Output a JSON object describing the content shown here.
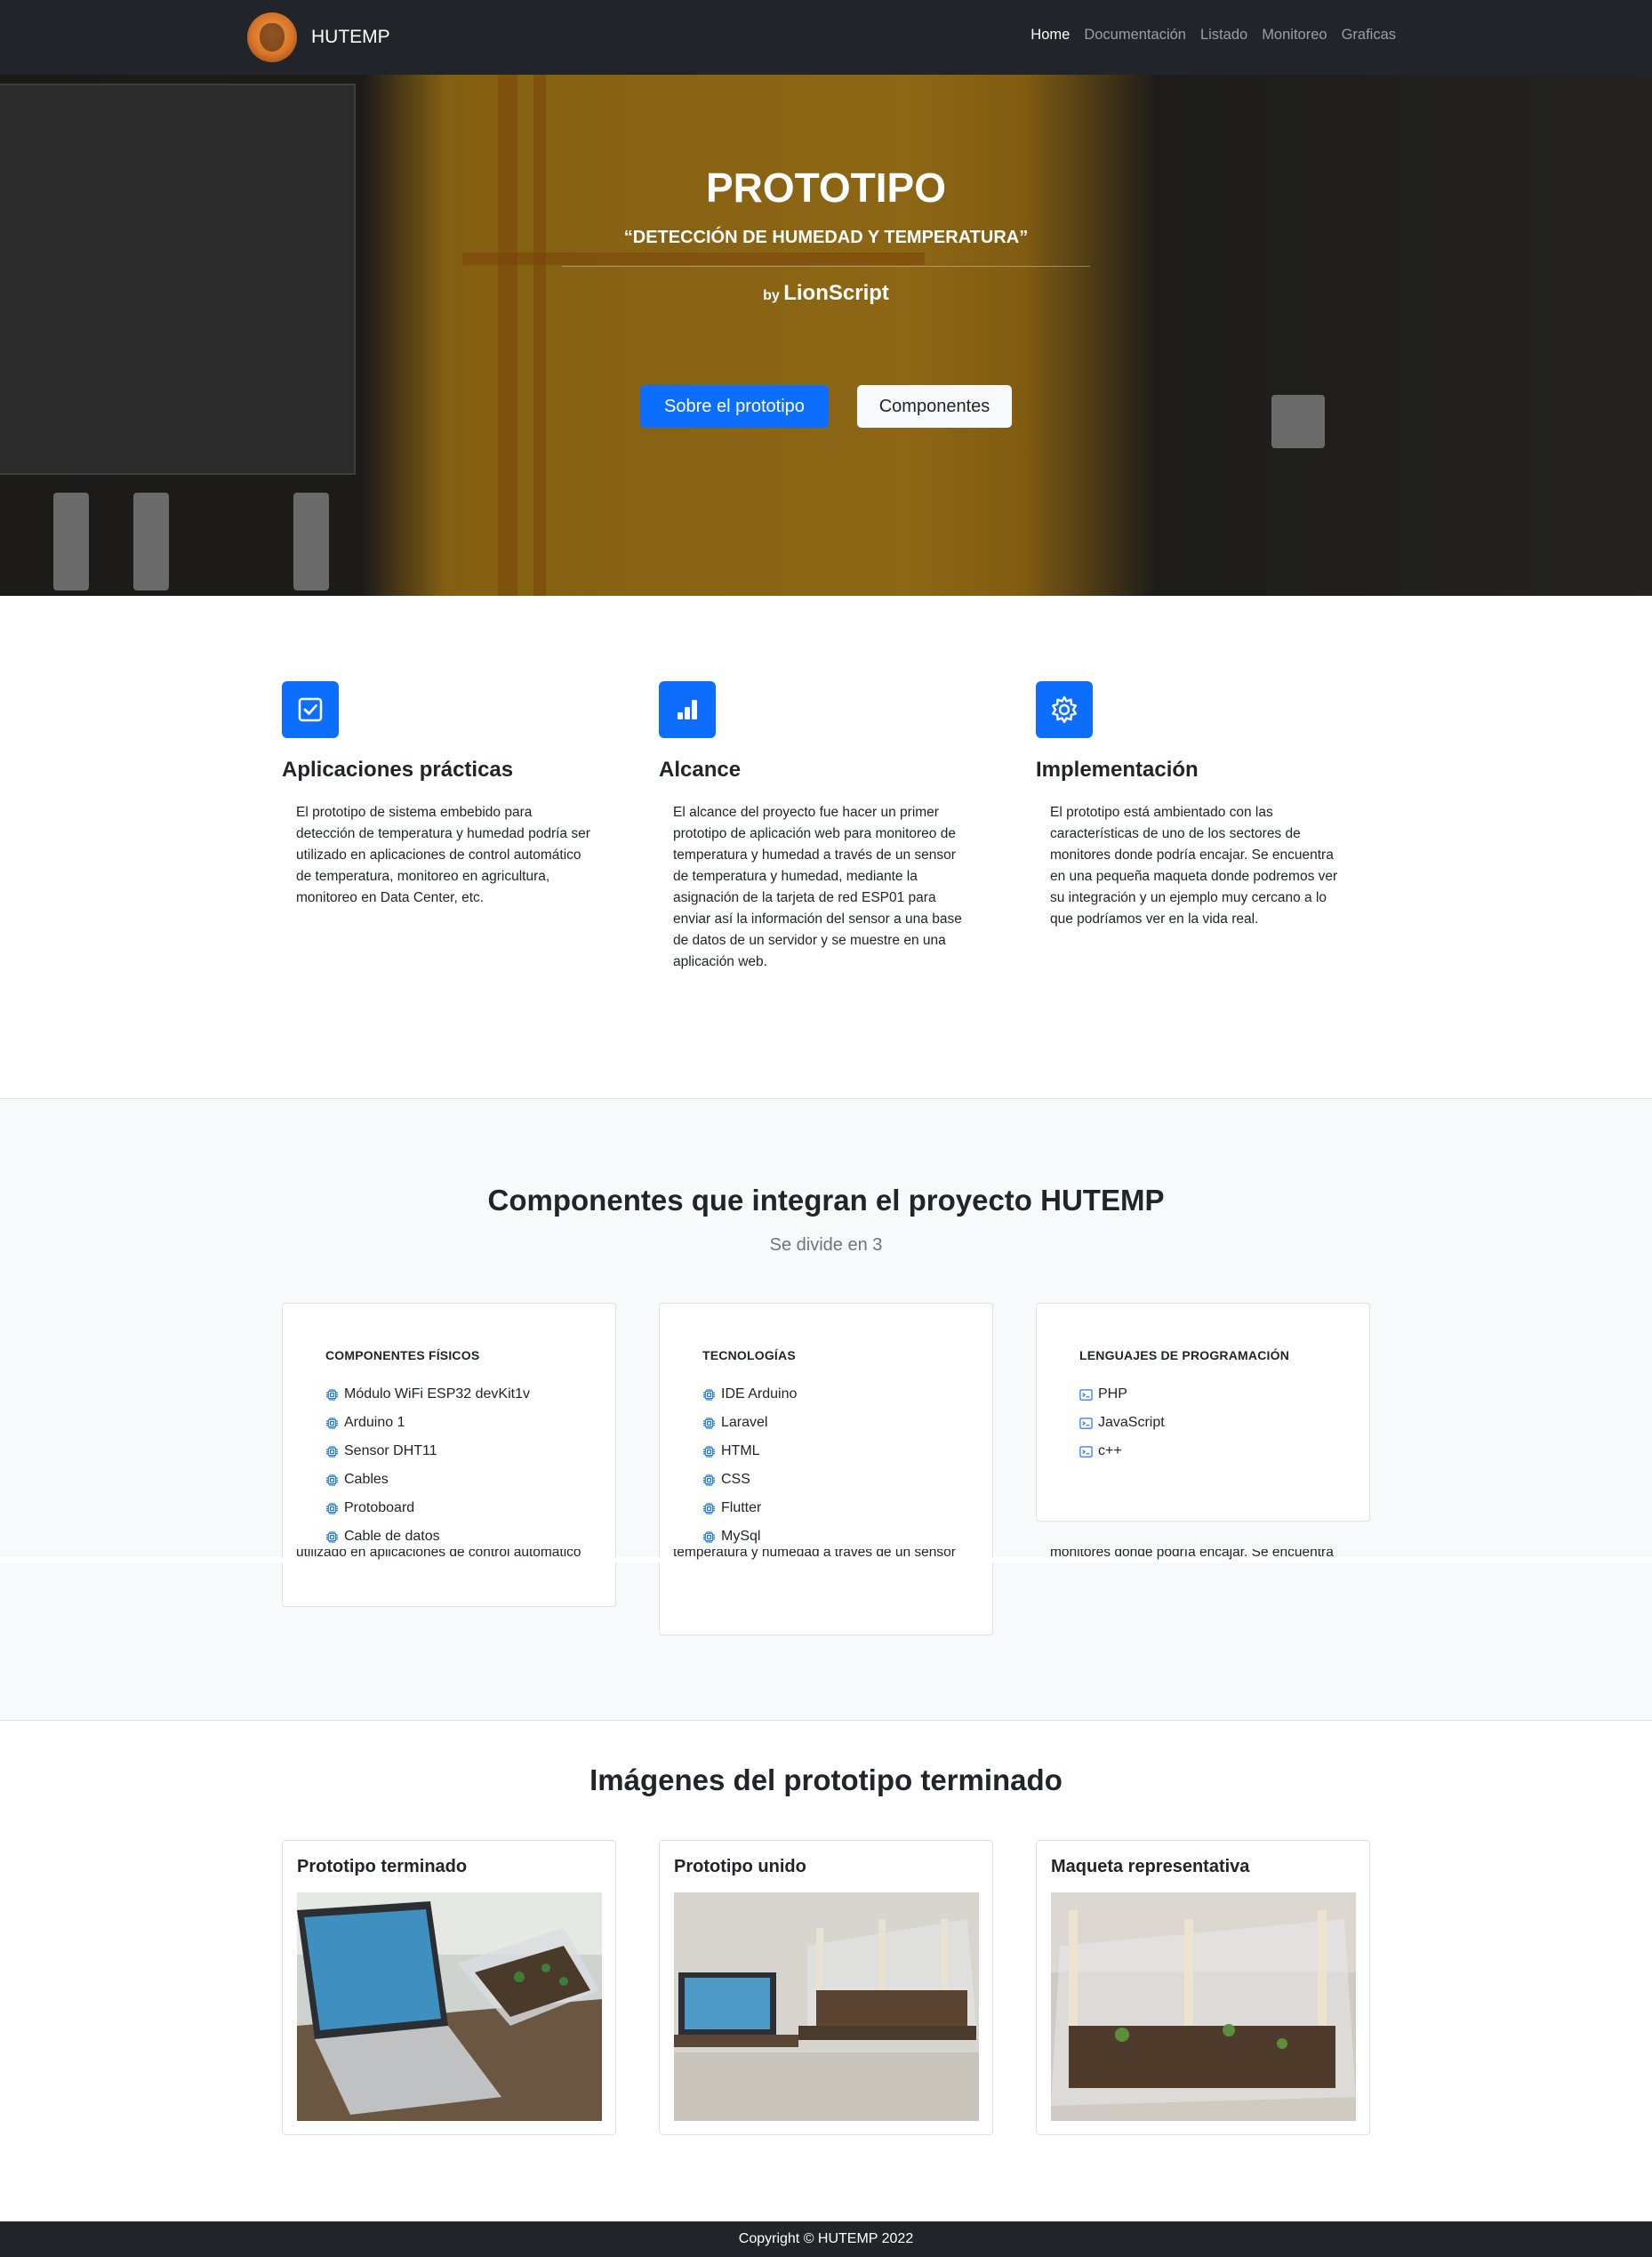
{
  "nav": {
    "brand": "HUTEMP",
    "links": [
      "Home",
      "Documentación",
      "Listado",
      "Monitoreo",
      "Graficas"
    ],
    "active": "Home"
  },
  "hero": {
    "title": "PROTOTIPO",
    "subtitle": "“DETECCIÓN DE HUMEDAD Y TEMPERATURA”",
    "by_prefix": "by",
    "by_name": "LionScript",
    "primary_button": "Sobre el prototipo",
    "secondary_button": "Componentes"
  },
  "features": [
    {
      "icon": "check-square-icon",
      "title": "Aplicaciones prácticas",
      "text": "El prototipo de sistema embebido para detección de temperatura y humedad podría ser utilizado en aplicaciones de control automático de temperatura, monitoreo en agricultura, monitoreo en  Data Center, etc."
    },
    {
      "icon": "signal-bars-icon",
      "title": "Alcance",
      "text": "El alcance del proyecto fue hacer un primer prototipo de aplicación web para monitoreo de temperatura y humedad a través de un sensor de temperatura y humedad, mediante la asignación de la tarjeta de red ESP01 para enviar así la información del sensor a una base de datos de un servidor y se muestre en una aplicación web."
    },
    {
      "icon": "gear-icon",
      "title": "Implementación",
      "text": "El prototipo está ambientado con las características de uno de los sectores de monitores donde podría encajar. Se encuentra en una pequeña maqueta donde podremos ver su integración y un ejemplo muy cercano a lo que podríamos ver en la vida real."
    }
  ],
  "components": {
    "title": "Componentes que integran el proyecto HUTEMP",
    "subtitle": "Se divide en 3",
    "cards": [
      {
        "heading": "Componentes físicos",
        "icon": "cpu-icon",
        "items": [
          "Módulo WiFi ESP32 devKit1v",
          "Arduino 1",
          "Sensor DHT11",
          "Cables",
          "Protoboard",
          "Cable de datos"
        ]
      },
      {
        "heading": "Tecnologías",
        "icon": "cpu-icon",
        "items": [
          "IDE Arduino",
          "Laravel",
          "HTML",
          "CSS",
          "Flutter",
          "MySql"
        ]
      },
      {
        "heading": "Lenguajes de programación",
        "icon": "terminal-icon",
        "items": [
          "PHP",
          "JavaScript",
          "c++"
        ]
      }
    ],
    "overlap_fragments": [
      "utilizado en aplicaciones de control automático",
      "temperatura y humedad a través de un sensor",
      "monitores donde podría encajar. Se encuentra"
    ]
  },
  "gallery": {
    "title": "Imágenes del prototipo terminado",
    "cards": [
      {
        "title": "Prototipo terminado"
      },
      {
        "title": "Prototipo unido"
      },
      {
        "title": "Maqueta representativa"
      }
    ]
  },
  "footer": {
    "text": "Copyright © HUTEMP 2022"
  },
  "colors": {
    "navbar": "#212529",
    "primary": "#0d6efd",
    "section_bg": "#f8f9fa"
  }
}
